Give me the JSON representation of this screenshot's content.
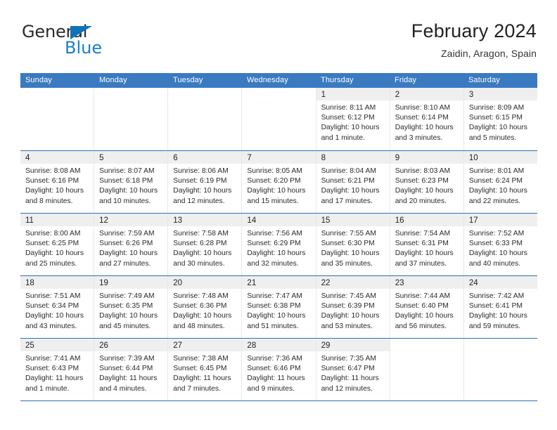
{
  "logo": {
    "word1": "General",
    "word2": "Blue",
    "triangle_color": "#1272b8",
    "blue_color": "#1b7fc4"
  },
  "header": {
    "title": "February 2024",
    "subtitle": "Zaidin, Aragon, Spain"
  },
  "theme": {
    "header_bg": "#3a7ac0",
    "row_rule": "#2f6fb5",
    "numband_bg": "#efefef",
    "cell_divider": "#e8e8e8"
  },
  "weekdays": [
    "Sunday",
    "Monday",
    "Tuesday",
    "Wednesday",
    "Thursday",
    "Friday",
    "Saturday"
  ],
  "labels": {
    "sunrise_prefix": "Sunrise: ",
    "sunset_prefix": "Sunset: ",
    "daylight_prefix": "Daylight: "
  },
  "weeks": [
    [
      {
        "blank": true
      },
      {
        "blank": true
      },
      {
        "blank": true
      },
      {
        "blank": true
      },
      {
        "day": "1",
        "sunrise": "Sunrise: 8:11 AM",
        "sunset": "Sunset: 6:12 PM",
        "daylight1": "Daylight: 10 hours",
        "daylight2": "and 1 minute."
      },
      {
        "day": "2",
        "sunrise": "Sunrise: 8:10 AM",
        "sunset": "Sunset: 6:14 PM",
        "daylight1": "Daylight: 10 hours",
        "daylight2": "and 3 minutes."
      },
      {
        "day": "3",
        "sunrise": "Sunrise: 8:09 AM",
        "sunset": "Sunset: 6:15 PM",
        "daylight1": "Daylight: 10 hours",
        "daylight2": "and 5 minutes."
      }
    ],
    [
      {
        "day": "4",
        "sunrise": "Sunrise: 8:08 AM",
        "sunset": "Sunset: 6:16 PM",
        "daylight1": "Daylight: 10 hours",
        "daylight2": "and 8 minutes."
      },
      {
        "day": "5",
        "sunrise": "Sunrise: 8:07 AM",
        "sunset": "Sunset: 6:18 PM",
        "daylight1": "Daylight: 10 hours",
        "daylight2": "and 10 minutes."
      },
      {
        "day": "6",
        "sunrise": "Sunrise: 8:06 AM",
        "sunset": "Sunset: 6:19 PM",
        "daylight1": "Daylight: 10 hours",
        "daylight2": "and 12 minutes."
      },
      {
        "day": "7",
        "sunrise": "Sunrise: 8:05 AM",
        "sunset": "Sunset: 6:20 PM",
        "daylight1": "Daylight: 10 hours",
        "daylight2": "and 15 minutes."
      },
      {
        "day": "8",
        "sunrise": "Sunrise: 8:04 AM",
        "sunset": "Sunset: 6:21 PM",
        "daylight1": "Daylight: 10 hours",
        "daylight2": "and 17 minutes."
      },
      {
        "day": "9",
        "sunrise": "Sunrise: 8:03 AM",
        "sunset": "Sunset: 6:23 PM",
        "daylight1": "Daylight: 10 hours",
        "daylight2": "and 20 minutes."
      },
      {
        "day": "10",
        "sunrise": "Sunrise: 8:01 AM",
        "sunset": "Sunset: 6:24 PM",
        "daylight1": "Daylight: 10 hours",
        "daylight2": "and 22 minutes."
      }
    ],
    [
      {
        "day": "11",
        "sunrise": "Sunrise: 8:00 AM",
        "sunset": "Sunset: 6:25 PM",
        "daylight1": "Daylight: 10 hours",
        "daylight2": "and 25 minutes."
      },
      {
        "day": "12",
        "sunrise": "Sunrise: 7:59 AM",
        "sunset": "Sunset: 6:26 PM",
        "daylight1": "Daylight: 10 hours",
        "daylight2": "and 27 minutes."
      },
      {
        "day": "13",
        "sunrise": "Sunrise: 7:58 AM",
        "sunset": "Sunset: 6:28 PM",
        "daylight1": "Daylight: 10 hours",
        "daylight2": "and 30 minutes."
      },
      {
        "day": "14",
        "sunrise": "Sunrise: 7:56 AM",
        "sunset": "Sunset: 6:29 PM",
        "daylight1": "Daylight: 10 hours",
        "daylight2": "and 32 minutes."
      },
      {
        "day": "15",
        "sunrise": "Sunrise: 7:55 AM",
        "sunset": "Sunset: 6:30 PM",
        "daylight1": "Daylight: 10 hours",
        "daylight2": "and 35 minutes."
      },
      {
        "day": "16",
        "sunrise": "Sunrise: 7:54 AM",
        "sunset": "Sunset: 6:31 PM",
        "daylight1": "Daylight: 10 hours",
        "daylight2": "and 37 minutes."
      },
      {
        "day": "17",
        "sunrise": "Sunrise: 7:52 AM",
        "sunset": "Sunset: 6:33 PM",
        "daylight1": "Daylight: 10 hours",
        "daylight2": "and 40 minutes."
      }
    ],
    [
      {
        "day": "18",
        "sunrise": "Sunrise: 7:51 AM",
        "sunset": "Sunset: 6:34 PM",
        "daylight1": "Daylight: 10 hours",
        "daylight2": "and 43 minutes."
      },
      {
        "day": "19",
        "sunrise": "Sunrise: 7:49 AM",
        "sunset": "Sunset: 6:35 PM",
        "daylight1": "Daylight: 10 hours",
        "daylight2": "and 45 minutes."
      },
      {
        "day": "20",
        "sunrise": "Sunrise: 7:48 AM",
        "sunset": "Sunset: 6:36 PM",
        "daylight1": "Daylight: 10 hours",
        "daylight2": "and 48 minutes."
      },
      {
        "day": "21",
        "sunrise": "Sunrise: 7:47 AM",
        "sunset": "Sunset: 6:38 PM",
        "daylight1": "Daylight: 10 hours",
        "daylight2": "and 51 minutes."
      },
      {
        "day": "22",
        "sunrise": "Sunrise: 7:45 AM",
        "sunset": "Sunset: 6:39 PM",
        "daylight1": "Daylight: 10 hours",
        "daylight2": "and 53 minutes."
      },
      {
        "day": "23",
        "sunrise": "Sunrise: 7:44 AM",
        "sunset": "Sunset: 6:40 PM",
        "daylight1": "Daylight: 10 hours",
        "daylight2": "and 56 minutes."
      },
      {
        "day": "24",
        "sunrise": "Sunrise: 7:42 AM",
        "sunset": "Sunset: 6:41 PM",
        "daylight1": "Daylight: 10 hours",
        "daylight2": "and 59 minutes."
      }
    ],
    [
      {
        "day": "25",
        "sunrise": "Sunrise: 7:41 AM",
        "sunset": "Sunset: 6:43 PM",
        "daylight1": "Daylight: 11 hours",
        "daylight2": "and 1 minute."
      },
      {
        "day": "26",
        "sunrise": "Sunrise: 7:39 AM",
        "sunset": "Sunset: 6:44 PM",
        "daylight1": "Daylight: 11 hours",
        "daylight2": "and 4 minutes."
      },
      {
        "day": "27",
        "sunrise": "Sunrise: 7:38 AM",
        "sunset": "Sunset: 6:45 PM",
        "daylight1": "Daylight: 11 hours",
        "daylight2": "and 7 minutes."
      },
      {
        "day": "28",
        "sunrise": "Sunrise: 7:36 AM",
        "sunset": "Sunset: 6:46 PM",
        "daylight1": "Daylight: 11 hours",
        "daylight2": "and 9 minutes."
      },
      {
        "day": "29",
        "sunrise": "Sunrise: 7:35 AM",
        "sunset": "Sunset: 6:47 PM",
        "daylight1": "Daylight: 11 hours",
        "daylight2": "and 12 minutes."
      },
      {
        "blank": true
      },
      {
        "blank": true
      }
    ]
  ]
}
